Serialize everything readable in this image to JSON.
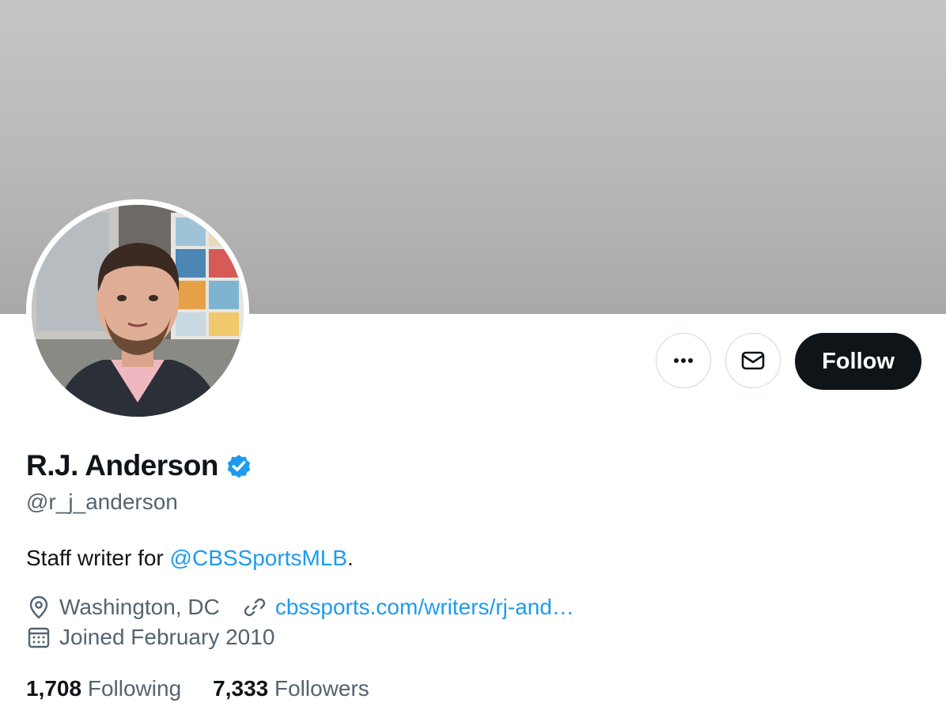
{
  "profile": {
    "name": "R.J. Anderson",
    "handle": "@r_j_anderson",
    "bio_prefix": "Staff writer for ",
    "bio_mention": "@CBSSportsMLB",
    "bio_suffix": ".",
    "location": "Washington, DC",
    "website": "cbssports.com/writers/rj-and…",
    "joined": "Joined February 2010",
    "following_count": "1,708",
    "following_label": "Following",
    "followers_count": "7,333",
    "followers_label": "Followers"
  },
  "actions": {
    "follow_label": "Follow"
  },
  "icons": {
    "more": "more-horizontal-icon",
    "message": "envelope-icon",
    "verified": "verified-badge-icon",
    "location": "location-pin-icon",
    "link": "link-icon",
    "calendar": "calendar-icon"
  },
  "colors": {
    "accent": "#1d9bf0",
    "follow_button": "#0f1419",
    "secondary_text": "#536471"
  }
}
